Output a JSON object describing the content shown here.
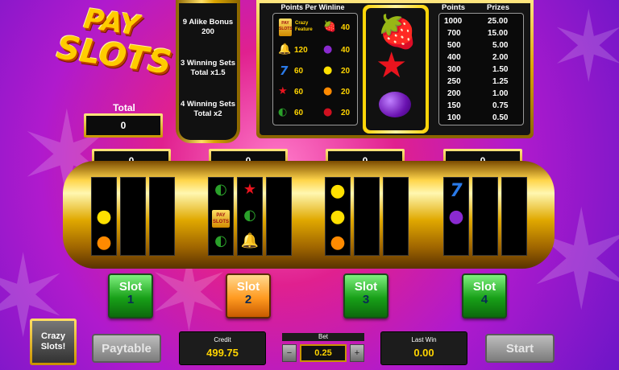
{
  "logo": {
    "line1": "PAY",
    "line2": "SLOTS"
  },
  "bonus_panel": {
    "lines": [
      "9 Alike Bonus 200",
      "3 Winning Sets Total x1.5",
      "4 Winning Sets Total x2"
    ]
  },
  "paytable": {
    "title": "Points Per Winline",
    "crazy_badge": "PAY SLOTS",
    "crazy_text": "Crazy Feature",
    "rows": [
      {
        "left_icon": "crazy-feature-icon",
        "left_value": "",
        "right_icon": "strawberry-icon",
        "right_value": "40"
      },
      {
        "left_icon": "bell-icon",
        "left_value": "120",
        "right_icon": "plum-icon",
        "right_value": "40"
      },
      {
        "left_icon": "seven-icon",
        "left_value": "60",
        "right_icon": "lemon-icon",
        "right_value": "20"
      },
      {
        "left_icon": "star-icon",
        "left_value": "60",
        "right_icon": "orange-icon",
        "right_value": "20"
      },
      {
        "left_icon": "watermelon-icon",
        "left_value": "60",
        "right_icon": "cherry-icon",
        "right_value": "20"
      }
    ],
    "feature_symbols": [
      "strawberry-icon",
      "star-icon",
      "plum-icon"
    ]
  },
  "prizes": {
    "points_header": "Points",
    "prizes_header": "Prizes",
    "rows": [
      {
        "points": "1000",
        "prize": "25.00"
      },
      {
        "points": "700",
        "prize": "15.00"
      },
      {
        "points": "500",
        "prize": "5.00"
      },
      {
        "points": "400",
        "prize": "2.00"
      },
      {
        "points": "300",
        "prize": "1.50"
      },
      {
        "points": "250",
        "prize": "1.25"
      },
      {
        "points": "200",
        "prize": "1.00"
      },
      {
        "points": "150",
        "prize": "0.75"
      },
      {
        "points": "100",
        "prize": "0.50"
      }
    ]
  },
  "total": {
    "label": "Total",
    "value": "0"
  },
  "slots": [
    {
      "score": "0",
      "button_label": "Slot",
      "button_number": "1",
      "active": false
    },
    {
      "score": "0",
      "button_label": "Slot",
      "button_number": "2",
      "active": true
    },
    {
      "score": "0",
      "button_label": "Slot",
      "button_number": "3",
      "active": false
    },
    {
      "score": "0",
      "button_label": "Slot",
      "button_number": "4",
      "active": false
    }
  ],
  "reels": [
    [
      [
        "",
        "lemon",
        "orange"
      ],
      [
        "",
        "",
        ""
      ],
      [
        "",
        "",
        ""
      ]
    ],
    [
      [
        "watermelon",
        "payslots",
        "watermelon"
      ],
      [
        "star",
        "watermelon",
        "bell"
      ],
      [
        "",
        "",
        ""
      ]
    ],
    [
      [
        "lemon",
        "lemon",
        "orange"
      ],
      [
        "",
        "",
        ""
      ],
      [
        "",
        "",
        ""
      ]
    ],
    [
      [
        "seven",
        "plum",
        ""
      ],
      [
        "",
        "",
        ""
      ],
      [
        "",
        "",
        ""
      ]
    ]
  ],
  "bottom_bar": {
    "crazy_button": "Crazy Slots!",
    "paytable_button": "Paytable",
    "credit_label": "Credit",
    "credit_value": "499.75",
    "bet_label": "Bet",
    "bet_value": "0.25",
    "last_win_label": "Last Win",
    "last_win_value": "0.00",
    "start_button": "Start"
  },
  "colors": {
    "gold": "#ffd400",
    "slot_button_green": "#18a018",
    "slot_button_active_orange": "#ff9a20",
    "background_magenta": "#e0208f",
    "background_purple": "#6d16c8"
  }
}
